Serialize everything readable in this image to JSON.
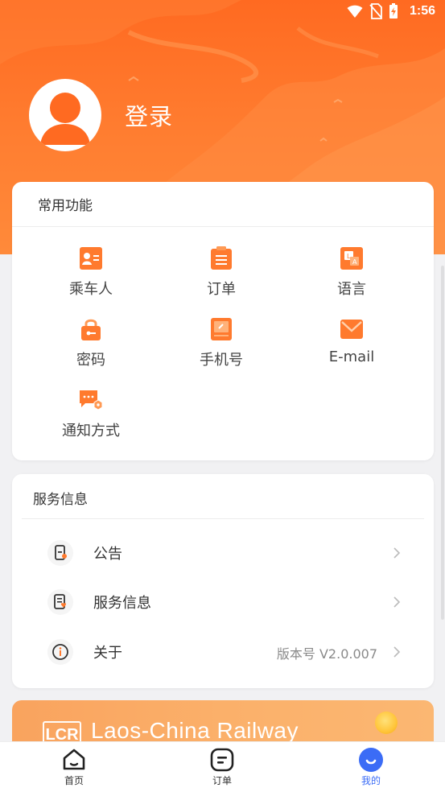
{
  "status_bar": {
    "time": "1:56",
    "icons": [
      "wifi-icon",
      "no-sim-icon",
      "battery-charging-icon"
    ]
  },
  "profile": {
    "login_label": "登录",
    "avatar_icon": "user-avatar-icon"
  },
  "features": {
    "title": "常用功能",
    "items": [
      {
        "label": "乘车人",
        "icon": "passenger-card-icon"
      },
      {
        "label": "订单",
        "icon": "order-list-icon"
      },
      {
        "label": "语言",
        "icon": "language-translate-icon"
      },
      {
        "label": "密码",
        "icon": "lock-icon"
      },
      {
        "label": "手机号",
        "icon": "phone-icon"
      },
      {
        "label": "E-mail",
        "icon": "mail-icon"
      },
      {
        "label": "通知方式",
        "icon": "notification-chat-icon"
      }
    ]
  },
  "service": {
    "title": "服务信息",
    "rows": [
      {
        "label": "公告",
        "value": "",
        "icon": "announcement-icon"
      },
      {
        "label": "服务信息",
        "value": "",
        "icon": "service-info-icon"
      },
      {
        "label": "关于",
        "value": "版本号 V2.0.007",
        "icon": "info-icon"
      }
    ]
  },
  "banner": {
    "text": "Laos-China Railway",
    "logo_text": "LCR"
  },
  "tabbar": {
    "tabs": [
      {
        "label": "首页",
        "icon": "home-icon"
      },
      {
        "label": "订单",
        "icon": "order-icon"
      },
      {
        "label": "我的",
        "icon": "profile-smile-icon",
        "active": true
      }
    ]
  },
  "colors": {
    "brand_orange": "#ff7a2e",
    "active_blue": "#3b6cf6",
    "icon_orange": "#ff7a2e"
  }
}
